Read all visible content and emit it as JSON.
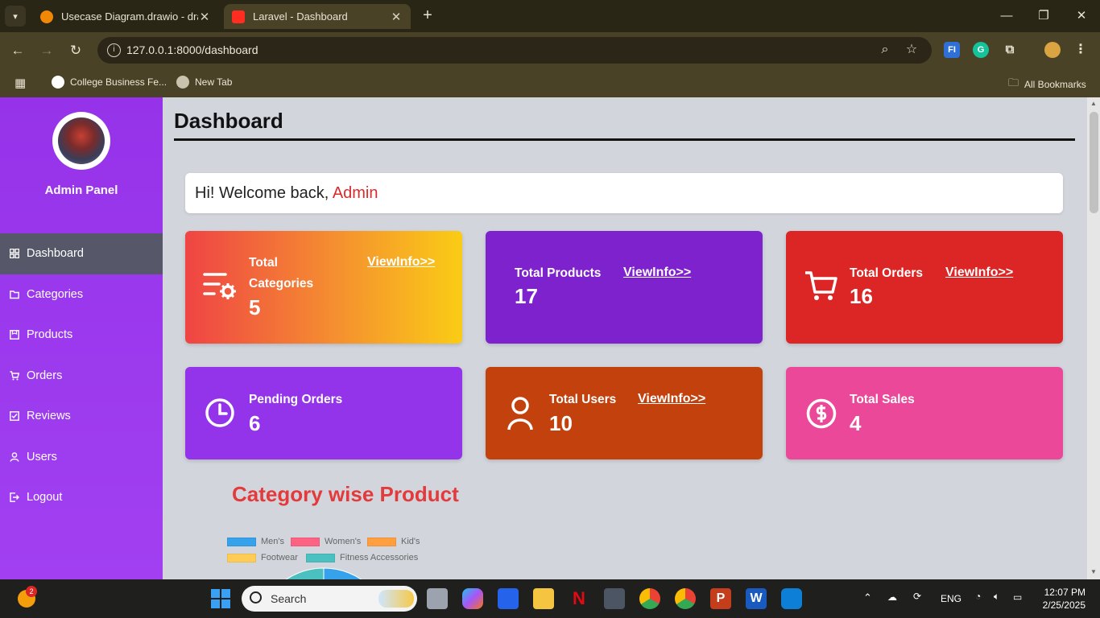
{
  "browser": {
    "tabs": [
      {
        "title": "Usecase Diagram.drawio - draw",
        "active": false
      },
      {
        "title": "Laravel - Dashboard",
        "active": true
      }
    ],
    "url": "127.0.0.1:8000/dashboard",
    "bookmarks": [
      {
        "label": "College Business Fe..."
      },
      {
        "label": "New Tab"
      }
    ],
    "all_bookmarks": "All Bookmarks"
  },
  "sidebar": {
    "panel_title": "Admin Panel",
    "items": [
      {
        "label": "Dashboard",
        "active": true,
        "icon": "dashboard-icon"
      },
      {
        "label": "Categories",
        "active": false,
        "icon": "folder-icon"
      },
      {
        "label": "Products",
        "active": false,
        "icon": "box-icon"
      },
      {
        "label": "Orders",
        "active": false,
        "icon": "cart-icon"
      },
      {
        "label": "Reviews",
        "active": false,
        "icon": "review-icon"
      },
      {
        "label": "Users",
        "active": false,
        "icon": "user-icon"
      },
      {
        "label": "Logout",
        "active": false,
        "icon": "logout-icon"
      }
    ]
  },
  "main": {
    "page_title": "Dashboard",
    "welcome_prefix": "Hi! Welcome back, ",
    "welcome_name": "Admin",
    "cards": [
      {
        "label_line1": "Total",
        "label_line2": "Categories",
        "value": "5",
        "link": "ViewInfo>>",
        "icon": "category-settings-icon"
      },
      {
        "label": "Total Products",
        "value": "17",
        "link": "ViewInfo>>"
      },
      {
        "label": "Total Orders",
        "value": "16",
        "link": "ViewInfo>>",
        "icon": "cart-icon"
      },
      {
        "label": "Pending Orders",
        "value": "6",
        "icon": "clock-icon"
      },
      {
        "label": "Total Users",
        "value": "10",
        "link": "ViewInfo>>",
        "icon": "user-icon"
      },
      {
        "label": "Total Sales",
        "value": "4",
        "icon": "dollar-icon"
      }
    ],
    "chart_title": "Category wise Product"
  },
  "chart_data": {
    "type": "pie",
    "title": "Category wise Product",
    "legend": [
      "Men's",
      "Women's",
      "Kid's",
      "Footwear",
      "Fitness Accessories"
    ],
    "colors": [
      "#36a2eb",
      "#ff6384",
      "#ff9f40",
      "#ffcd56",
      "#4bc0c0"
    ],
    "legend_placement": "top"
  },
  "taskbar": {
    "search_label": "Search",
    "language": "ENG",
    "time": "12:07 PM",
    "date": "2/25/2025",
    "notification_count": "2"
  }
}
